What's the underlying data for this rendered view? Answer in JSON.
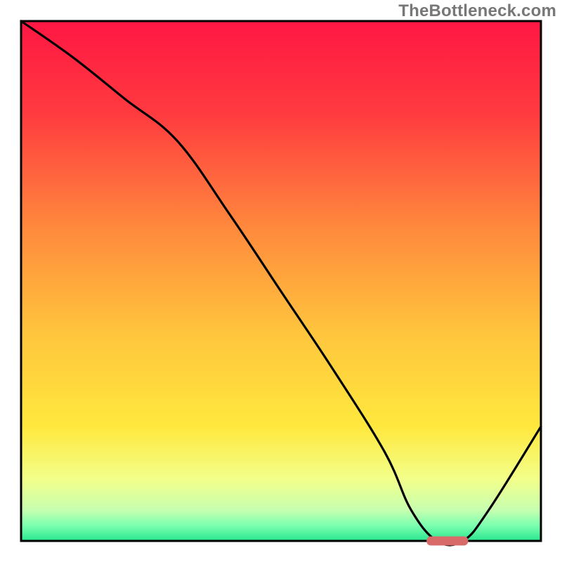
{
  "watermark": "TheBottleneck.com",
  "chart_data": {
    "type": "line",
    "title": "",
    "xlabel": "",
    "ylabel": "",
    "xlim": [
      0,
      100
    ],
    "ylim": [
      0,
      100
    ],
    "grid": false,
    "legend": false,
    "series": [
      {
        "name": "bottleneck-curve",
        "x": [
          0,
          10,
          20,
          30,
          40,
          50,
          60,
          70,
          75,
          80,
          85,
          90,
          100
        ],
        "y": [
          100,
          93,
          85,
          77,
          63,
          48,
          33,
          17,
          6,
          0,
          0,
          6,
          22
        ]
      }
    ],
    "marker": {
      "name": "optimal-zone",
      "x_range": [
        78,
        86
      ],
      "y": 0,
      "color": "#d96a6a"
    },
    "background_gradient": {
      "stops": [
        {
          "offset": 0.0,
          "color": "#ff1744"
        },
        {
          "offset": 0.18,
          "color": "#ff3b3f"
        },
        {
          "offset": 0.4,
          "color": "#ff8a3d"
        },
        {
          "offset": 0.6,
          "color": "#ffc53d"
        },
        {
          "offset": 0.78,
          "color": "#ffe83d"
        },
        {
          "offset": 0.88,
          "color": "#f3ff8a"
        },
        {
          "offset": 0.94,
          "color": "#c8ffb0"
        },
        {
          "offset": 0.97,
          "color": "#7dffb0"
        },
        {
          "offset": 1.0,
          "color": "#29e68f"
        }
      ]
    }
  }
}
